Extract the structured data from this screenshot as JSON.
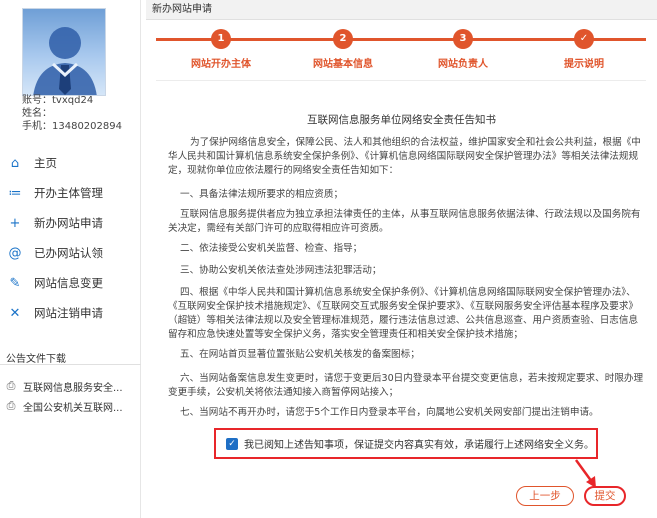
{
  "user": {
    "account": "账号：tvxqd24",
    "name": "姓名：",
    "phone": "手机：13480202894"
  },
  "menu": [
    {
      "icon": "home-icon",
      "glyph": "⌂",
      "label": "主页"
    },
    {
      "icon": "list-icon",
      "glyph": "≔",
      "label": "开办主体管理"
    },
    {
      "icon": "plus-icon",
      "glyph": "+",
      "label": "新办网站申请"
    },
    {
      "icon": "at-icon",
      "glyph": "@",
      "label": "已办网站认领"
    },
    {
      "icon": "edit-icon",
      "glyph": "✎",
      "label": "网站信息变更"
    },
    {
      "icon": "close-icon",
      "glyph": "✕",
      "label": "网站注销申请"
    }
  ],
  "notices": {
    "title": "公告文件下载",
    "items": [
      {
        "icon": "download-icon",
        "label": "互联网信息服务安全..."
      },
      {
        "icon": "download-icon",
        "label": "全国公安机关互联网..."
      }
    ]
  },
  "panel": {
    "title": "新办网站申请"
  },
  "steps": [
    {
      "num": "1",
      "label": "网站开办主体"
    },
    {
      "num": "2",
      "label": "网站基本信息"
    },
    {
      "num": "3",
      "label": "网站负责人"
    },
    {
      "num": "✓",
      "label": "提示说明"
    }
  ],
  "colors": {
    "accent": "#e0552c",
    "highlight": "#e8262a",
    "link": "#1a73c8"
  },
  "doc": {
    "title": "互联网信息服务单位网络安全责任告知书",
    "intro": "为了保护网络信息安全，保障公民、法人和其他组织的合法权益，维护国家安全和社会公共利益，根据《中华人民共和国计算机信息系统安全保护条例》、《计算机信息网络国际联网安全保护管理办法》等相关法律法规规定，现就你单位应依法履行的网络安全责任告知如下：",
    "items": [
      "一、具备法律法规所要求的相应资质；",
      "互联网信息服务提供者应为独立承担法律责任的主体，从事互联网信息服务依据法律、行政法规以及国务院有关决定，需经有关部门许可的应取得相应许可资质。",
      "二、依法接受公安机关监督、检查、指导；",
      "三、协助公安机关依法查处涉网违法犯罪活动；",
      "四、根据《中华人民共和国计算机信息系统安全保护条例》、《计算机信息网络国际联网安全保护管理办法》、《互联网安全保护技术措施规定》、《互联网交互式服务安全保护要求》、《互联网服务安全评估基本程序及要求》（超链）等相关法律法规以及安全管理标准规范，履行违法信息过滤、公共信息巡查、用户资质查验、日志信息留存和应急快速处置等安全保护义务，落实安全管理责任和相关安全保护技术措施；",
      "五、在网站首页显著位置张贴公安机关核发的备案图标；",
      "六、当网站备案信息发生变更时，请您于变更后30日内登录本平台提交变更信息，若未按规定要求、时限办理变更手续，公安机关将依法通知接入商暂停网站接入；",
      "七、当网站不再开办时，请您于5个工作日内登录本平台，向属地公安机关网安部门提出注销申请。"
    ]
  },
  "agreement": {
    "checked": true,
    "text": "我已阅知上述告知事项，保证提交内容真实有效，承诺履行上述网络安全义务。"
  },
  "buttons": {
    "prev": "上一步",
    "submit": "提交"
  }
}
